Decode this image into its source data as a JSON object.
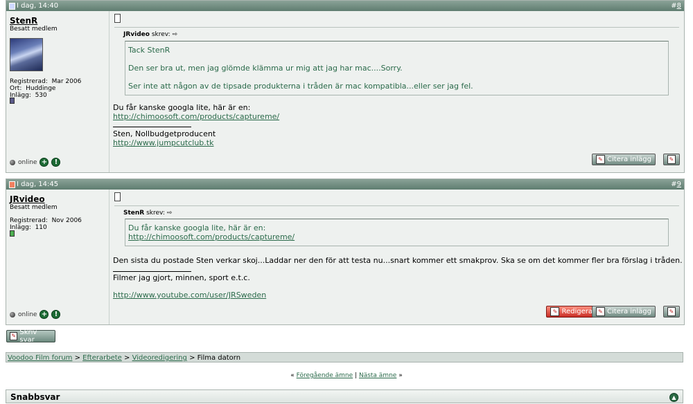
{
  "posts": [
    {
      "date": "I dag, 14:40",
      "number_prefix": "#",
      "number": "8",
      "user": {
        "name": "StenR",
        "title": "Besatt medlem",
        "registered_label": "Registrerad:",
        "registered": "Mar 2006",
        "location_label": "Ort:",
        "location": "Huddinge",
        "posts_label": "Inlägg:",
        "posts": "530",
        "status": "online",
        "rep_color": "#5a5a8a"
      },
      "quote": {
        "author": "JRvideo",
        "says": "skrev:",
        "paragraphs": [
          "Tack StenR",
          "Den ser bra ut, men jag glömde klämma ur mig att jag har mac....Sorry.",
          "Ser inte att någon av de tipsade produkterna i tråden är mac kompatibla...eller ser jag fel."
        ]
      },
      "body_text": "Du får kanske googla lite, här är en:",
      "body_link": "http://chimoosoft.com/products/captureme/",
      "signature": {
        "line1": "Sten, Nollbudgetproducent",
        "link": "http://www.jumpcutclub.tk"
      },
      "buttons": {
        "quote": "Citera inlägg"
      }
    },
    {
      "date": "I dag, 14:45",
      "number_prefix": "#",
      "number": "9",
      "user": {
        "name": "JRvideo",
        "title": "Besatt medlem",
        "registered_label": "Registrerad:",
        "registered": "Nov 2006",
        "posts_label": "Inlägg:",
        "posts": "110",
        "status": "online",
        "rep_color": "#4caf50"
      },
      "quote": {
        "author": "StenR",
        "says": "skrev:",
        "line1": "Du får kanske googla lite, här är en:",
        "link": "http://chimoosoft.com/products/captureme/"
      },
      "body_text": "Den sista du postade Sten verkar skoj...Laddar ner den för att testa nu...snart kommer ett smakprov. Ska se om det kommer fler bra förslag i tråden.",
      "signature": {
        "line1": "Filmer jag gjort, minnen, sport e.t.c.",
        "link": "http://www.youtube.com/user/JRSweden"
      },
      "buttons": {
        "edit": "Redigera",
        "quote": "Citera inlägg"
      }
    }
  ],
  "reply_button": "Skriv svar",
  "breadcrumb": {
    "items": [
      "Voodoo Film forum",
      "Efterarbete",
      "Videoredigering"
    ],
    "current": "Filma datorn",
    "separator": ">"
  },
  "nav": {
    "prev_arrow": "«",
    "prev": "Föregående ämne",
    "sep": "|",
    "next": "Nästa ämne",
    "next_arrow": "»"
  },
  "quick_reply": "Snabbsvar",
  "colors": {
    "header": "#5f7d70",
    "link": "#2a6a4a",
    "edit_button": "#c82e26"
  }
}
